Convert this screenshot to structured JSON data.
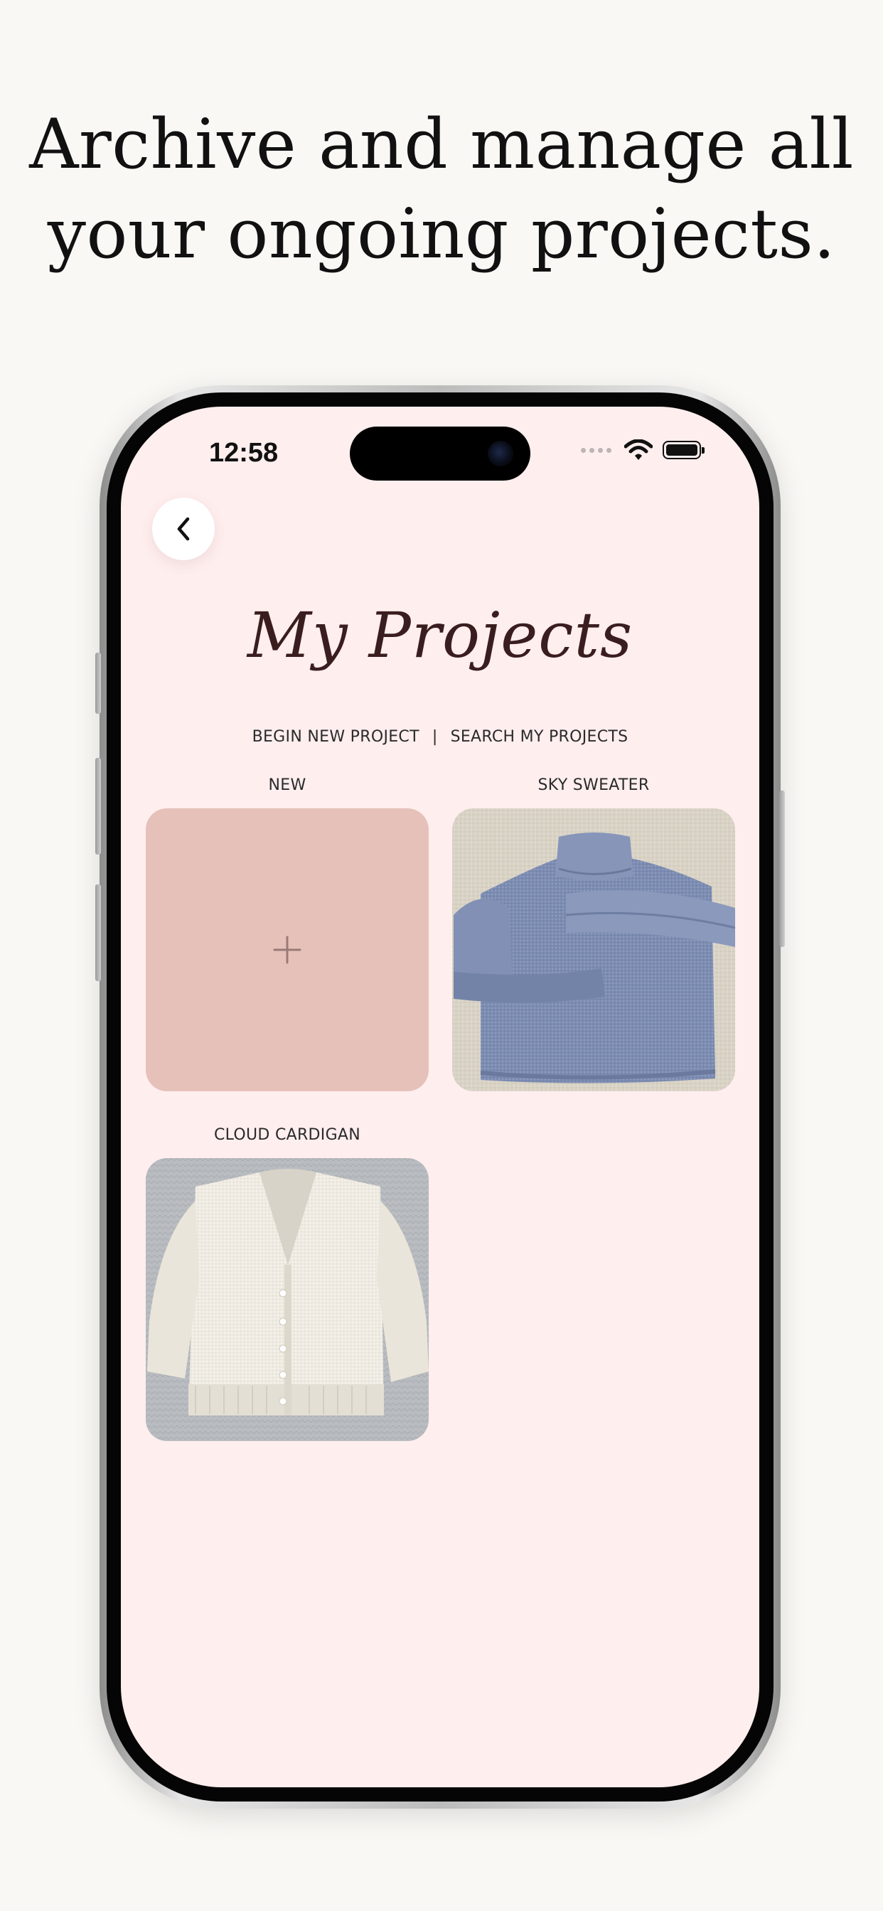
{
  "promo": {
    "headline_line1": "Archive and manage all",
    "headline_line2": "your ongoing projects."
  },
  "status_bar": {
    "time": "12:58",
    "icons": [
      "cellular-dots-icon",
      "wifi-icon",
      "battery-icon"
    ]
  },
  "nav": {
    "back_icon": "chevron-left-icon"
  },
  "page": {
    "title": "My Projects",
    "actions": {
      "begin_new": "BEGIN NEW PROJECT",
      "separator": "|",
      "search": "SEARCH MY PROJECTS"
    }
  },
  "projects": [
    {
      "label": "NEW",
      "type": "new",
      "icon": "plus-icon"
    },
    {
      "label": "SKY SWEATER",
      "type": "photo",
      "colors": {
        "garment": "#7d8db2",
        "background": "#d9d3c6"
      }
    },
    {
      "label": "CLOUD CARDIGAN",
      "type": "photo",
      "colors": {
        "garment": "#efebe2",
        "background": "#b9bcc0"
      }
    }
  ],
  "colors": {
    "screen_background": "#ffeeee",
    "new_tile": "#e6c1ba",
    "title": "#3a1d1f"
  }
}
